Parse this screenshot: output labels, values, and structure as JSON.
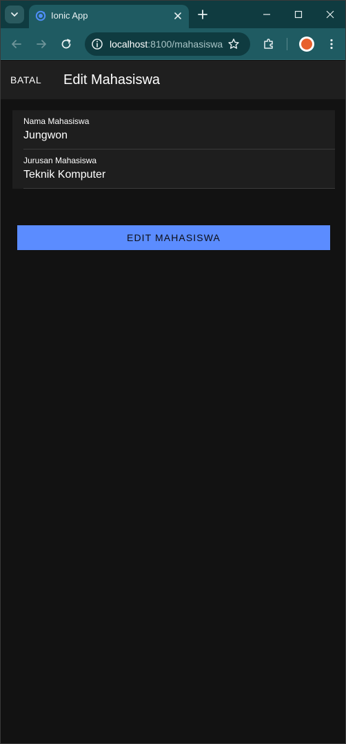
{
  "browser": {
    "tab_title": "Ionic App",
    "url_host": "localhost",
    "url_rest": ":8100/mahasiswa"
  },
  "header": {
    "cancel_label": "BATAL",
    "title": "Edit Mahasiswa"
  },
  "form": {
    "fields": [
      {
        "label": "Nama Mahasiswa",
        "value": "Jungwon"
      },
      {
        "label": "Jurusan Mahasiswa",
        "value": "Teknik Komputer"
      }
    ],
    "submit_label": "EDIT MAHASISWA"
  },
  "colors": {
    "browser_frame": "#0f3b40",
    "browser_toolbar": "#1f5b62",
    "app_background": "#121212",
    "header_background": "#1f1f1f",
    "primary_button": "#5b8cff"
  }
}
